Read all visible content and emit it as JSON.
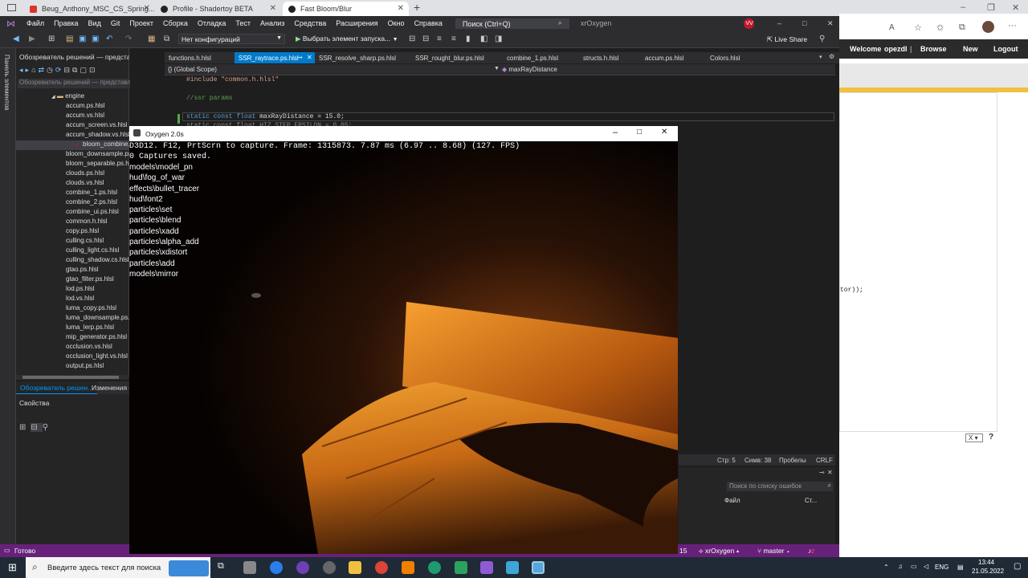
{
  "browser_tabs": [
    {
      "label": "Beug_Anthony_MSC_CS_Spring...",
      "favicon_color": "#d9362b"
    },
    {
      "label": "Profile - Shadertoy BETA",
      "favicon_color": "#222222"
    },
    {
      "label": "Fast Bloom/Blur",
      "favicon_color": "#222222"
    }
  ],
  "vs": {
    "menu": [
      "Файл",
      "Правка",
      "Вид",
      "Git",
      "Проект",
      "Сборка",
      "Отладка",
      "Тест",
      "Анализ",
      "Средства",
      "Расширения",
      "Окно",
      "Справка"
    ],
    "search_placeholder": "Поиск (Ctrl+Q)",
    "solution_name": "xrOxygen",
    "user_badge": "VV",
    "config": "Нет конфигураций",
    "run_label": "Выбрать элемент запуска...",
    "live_share": "Live Share",
    "left_strip_label": "Панель элементов",
    "solution_explorer": {
      "title": "Обозреватель решений — представление пап...",
      "search_placeholder": "Обозреватель решений — представление п",
      "folder": "engine",
      "files": [
        {
          "name": "accum.ps.hlsl",
          "mark": "✓",
          "mark_color": "#3c9"
        },
        {
          "name": "accum.vs.hlsl",
          "mark": "✓",
          "mark_color": "#3c9"
        },
        {
          "name": "accum_screen.vs.hlsl",
          "mark": "✓",
          "mark_color": "#3c9"
        },
        {
          "name": "accum_shadow.vs.hlsl",
          "mark": "✓",
          "mark_color": "#3c9"
        },
        {
          "name": "bloom_combine.ps.hlsl",
          "mark": "✓",
          "mark_color": "#e04"
        },
        {
          "name": "bloom_downsample.ps.hlsl",
          "mark": "✓",
          "mark_color": "#e04"
        },
        {
          "name": "bloom_separable.ps.hlsl",
          "mark": "✓",
          "mark_color": "#e04"
        },
        {
          "name": "clouds.ps.hlsl",
          "mark": "✓",
          "mark_color": "#3c9"
        },
        {
          "name": "clouds.vs.hlsl",
          "mark": "✓",
          "mark_color": "#3c9"
        },
        {
          "name": "combine_1.ps.hlsl",
          "mark": "✓",
          "mark_color": "#e04"
        },
        {
          "name": "combine_2.ps.hlsl",
          "mark": "✓",
          "mark_color": "#3c9"
        },
        {
          "name": "combine_ui.ps.hlsl",
          "mark": "✓",
          "mark_color": "#3c9"
        },
        {
          "name": "common.h.hlsl",
          "mark": "✓",
          "mark_color": "#e04"
        },
        {
          "name": "copy.ps.hlsl",
          "mark": "✓",
          "mark_color": "#3c9"
        },
        {
          "name": "culling.cs.hlsl",
          "mark": "✓",
          "mark_color": "#3c9"
        },
        {
          "name": "culling_light.cs.hlsl",
          "mark": "✓",
          "mark_color": "#3c9"
        },
        {
          "name": "culling_shadow.cs.hlsl",
          "mark": "✓",
          "mark_color": "#3c9"
        },
        {
          "name": "gtao.ps.hlsl",
          "mark": "✓",
          "mark_color": "#3c9"
        },
        {
          "name": "gtao_filter.ps.hlsl",
          "mark": "✓",
          "mark_color": "#3c9"
        },
        {
          "name": "lod.ps.hlsl",
          "mark": "✓",
          "mark_color": "#3c9"
        },
        {
          "name": "lod.vs.hlsl",
          "mark": "✓",
          "mark_color": "#3c9"
        },
        {
          "name": "luma_copy.ps.hlsl",
          "mark": "✓",
          "mark_color": "#3c9"
        },
        {
          "name": "luma_downsample.ps.hlsl",
          "mark": "✓",
          "mark_color": "#3c9"
        },
        {
          "name": "luma_lerp.ps.hlsl",
          "mark": "✓",
          "mark_color": "#3c9"
        },
        {
          "name": "mip_generator.ps.hlsl",
          "mark": "✓",
          "mark_color": "#3c9"
        },
        {
          "name": "occlusion.vs.hlsl",
          "mark": "✓",
          "mark_color": "#3c9"
        },
        {
          "name": "occlusion_light.vs.hlsl",
          "mark": "✓",
          "mark_color": "#3c9"
        },
        {
          "name": "output.ps.hlsl",
          "mark": "✓",
          "mark_color": "#3c9"
        }
      ],
      "tab_active": "Обозреватель решен...",
      "tab_other": "Изменения G"
    },
    "properties_title": "Свойства",
    "doc_tabs": [
      "functions.h.hlsl",
      "SSR_raytrace.ps.hlsl",
      "SSR_resolve_sharp.ps.hlsl",
      "SSR_rought_blur.ps.hlsl",
      "combine_1.ps.hlsl",
      "structs.h.hlsl",
      "accum.ps.hlsl",
      "Colors.hlsl"
    ],
    "scope": "(Global Scope)",
    "member": "maxRayDistance",
    "code": [
      {
        "text": "#include \"common.h.hlsl\"",
        "color": "#d69d85"
      },
      {
        "text": "//ssr params",
        "color": "#57a64a"
      },
      {
        "text_kw": "static const float ",
        "text_id": "maxRayDistance",
        "text_rest": " = 15.0;"
      },
      {
        "text": "static const float HIZ_STEP_EPSILON = 0.05;",
        "color": "#888"
      }
    ],
    "code_fragment": "tor));",
    "status_edit": {
      "line": "Стр: 5",
      "col": "Симв: 38",
      "spaces": "Пробелы",
      "eol": "CRLF"
    },
    "errlist": {
      "search": "Поиск по списку ошибок",
      "col_file": "Файл",
      "col_line": "Ст..."
    },
    "statusbar": {
      "ready": "Готово",
      "count": "15",
      "repo": "xrOxygen",
      "branch": "master",
      "changes": "2"
    }
  },
  "shadertoy": {
    "nav": [
      "Welcome",
      "opezdl",
      "Browse",
      "New",
      "Logout"
    ],
    "lang_select": "X",
    "help": "?"
  },
  "game": {
    "title": "Oxygen 2.0s",
    "console_mono": [
      "D3D12. F12, PrtScrn to capture. Frame: 1315873. 7.87 ms (6.97 .. 8.68) (127. FPS)",
      "0 Captures saved."
    ],
    "console_lines": [
      "models\\model_pn",
      "hud\\fog_of_war",
      "effects\\bullet_tracer",
      "hud\\font2",
      "particles\\set",
      "particles\\blend",
      "particles\\xadd",
      "particles\\alpha_add",
      "particles\\xdistort",
      "particles\\add",
      "models\\mirror"
    ]
  },
  "taskbar": {
    "search_placeholder": "Введите здесь текст для поиска",
    "lang": "ENG",
    "time": "13:44",
    "date": "21.05.2022"
  }
}
